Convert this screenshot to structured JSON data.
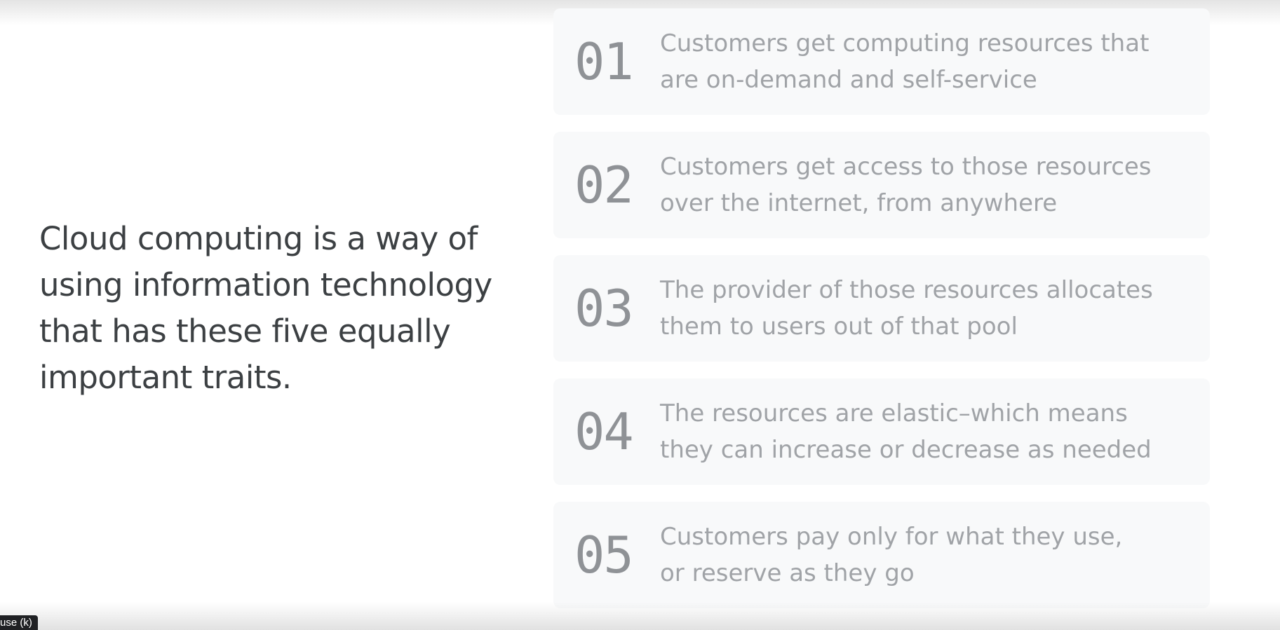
{
  "slide": {
    "intro": "Cloud computing is a way of using information technology that has these five equally important traits.",
    "traits": [
      {
        "number": "01",
        "text": "Customers get computing resources that\nare on-demand and self-service"
      },
      {
        "number": "02",
        "text": "Customers get access to those resources\nover the internet, from anywhere"
      },
      {
        "number": "03",
        "text": "The provider of those resources allocates\nthem to users out of that pool"
      },
      {
        "number": "04",
        "text": "The resources are elastic–which means\nthey can increase or decrease as needed"
      },
      {
        "number": "05",
        "text": "Customers pay only for what they use,\nor reserve as they go"
      }
    ]
  },
  "player": {
    "tooltip": "use (k)"
  }
}
